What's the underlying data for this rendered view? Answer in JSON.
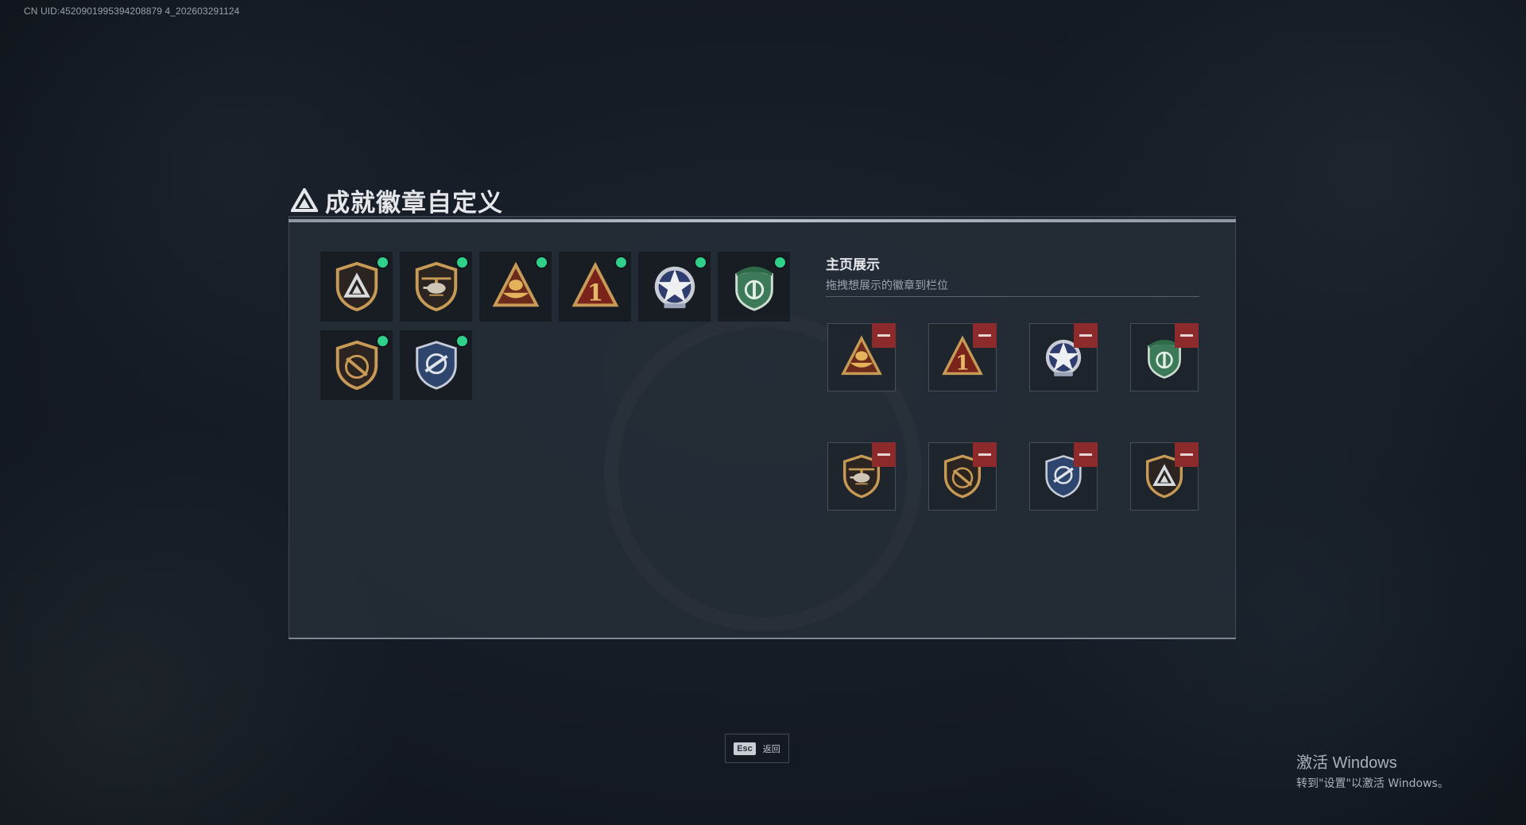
{
  "uid": "CN UID:4520901995394208879 4_202603291124",
  "page": {
    "title": "成就徽章自定义"
  },
  "owned_badges": [
    {
      "icon": "shield-triangle-badge-icon",
      "equipped": true
    },
    {
      "icon": "helicopter-shield-badge-icon",
      "equipped": true
    },
    {
      "icon": "boat-triangle-badge-icon",
      "equipped": true
    },
    {
      "icon": "number-one-triangle-badge-icon",
      "equipped": true
    },
    {
      "icon": "star-wings-badge-icon",
      "equipped": true
    },
    {
      "icon": "green-beret-shield-badge-icon",
      "equipped": true
    },
    {
      "icon": "rifle-shield-badge-icon",
      "equipped": true
    },
    {
      "icon": "blue-wreath-shield-badge-icon",
      "equipped": true
    }
  ],
  "showcase": {
    "title": "主页展示",
    "subtitle": "拖拽想展示的徽章到栏位",
    "slots": [
      {
        "icon": "boat-triangle-badge-icon"
      },
      {
        "icon": "number-one-triangle-badge-icon"
      },
      {
        "icon": "star-wings-badge-icon"
      },
      {
        "icon": "green-beret-shield-badge-icon"
      },
      {
        "icon": "helicopter-shield-badge-icon"
      },
      {
        "icon": "rifle-shield-badge-icon"
      },
      {
        "icon": "blue-wreath-shield-badge-icon"
      },
      {
        "icon": "shield-triangle-badge-icon"
      }
    ]
  },
  "footer": {
    "esc_key": "Esc",
    "esc_label": "返回"
  },
  "watermark": {
    "title": "激活 Windows",
    "subtitle": "转到\"设置\"以激活 Windows。"
  },
  "colors": {
    "equipped_dot": "#2fd08a",
    "remove": "#8d2a2c",
    "gold": "#c79a55"
  }
}
